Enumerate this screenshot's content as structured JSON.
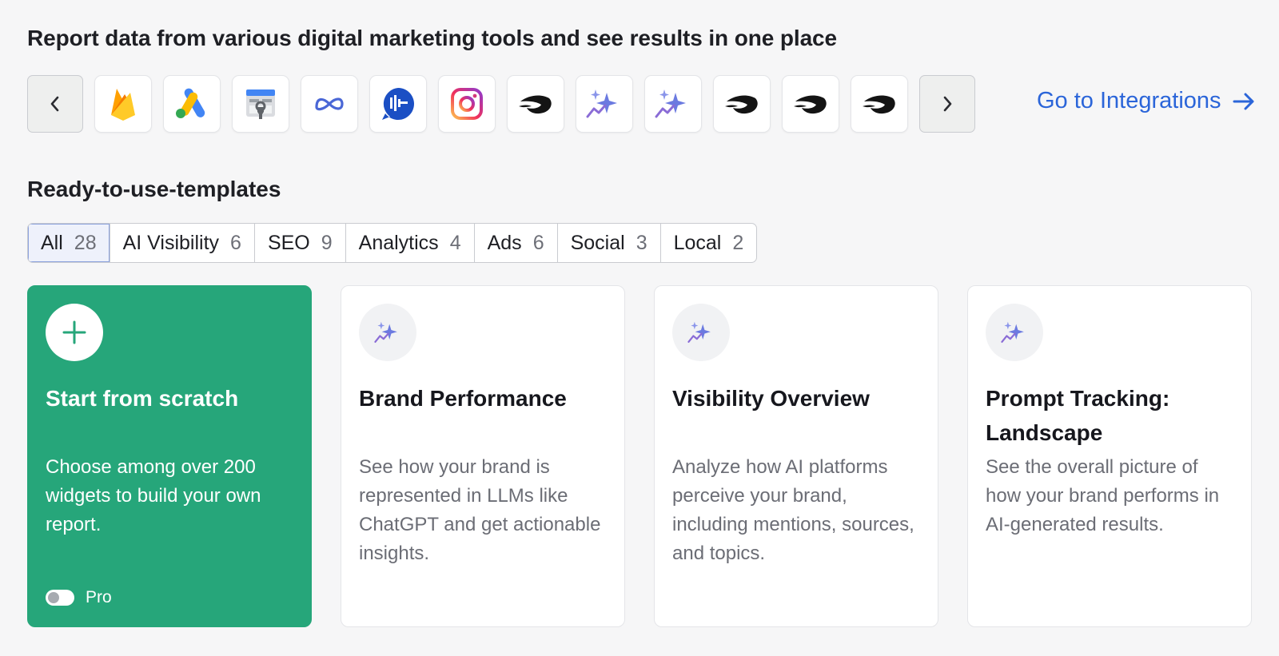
{
  "heading": "Report data from various digital marketing tools and see results in one place",
  "integrations": {
    "prev_label": "previous",
    "next_label": "next",
    "tools": [
      "firebase-icon",
      "google-ads-icon",
      "google-search-console-icon",
      "meta-icon",
      "dialpad-icon",
      "instagram-icon",
      "semrush-icon",
      "ai-sparkle-icon",
      "ai-sparkle-icon",
      "semrush-icon",
      "semrush-icon",
      "semrush-icon"
    ],
    "link_label": "Go to Integrations",
    "link_color": "#2b65d9"
  },
  "templates_heading": "Ready-to-use-templates",
  "tabs": [
    {
      "label": "All",
      "count": "28",
      "active": true
    },
    {
      "label": "AI Visibility",
      "count": "6"
    },
    {
      "label": "SEO",
      "count": "9"
    },
    {
      "label": "Analytics",
      "count": "4"
    },
    {
      "label": "Ads",
      "count": "6"
    },
    {
      "label": "Social",
      "count": "3"
    },
    {
      "label": "Local",
      "count": "2"
    }
  ],
  "cards": [
    {
      "title": "Start from scratch",
      "desc": "Choose among over 200 widgets to build your own report.",
      "icon": "plus-icon",
      "toggle_label": "Pro",
      "color": "#26a67a"
    },
    {
      "title": "Brand Performance",
      "desc": "See how your brand is represented in LLMs like ChatGPT and get actionable insights.",
      "icon": "ai-sparkle-icon"
    },
    {
      "title": "Visibility Overview",
      "desc": "Analyze how AI platforms perceive your brand, including mentions, sources, and topics.",
      "icon": "ai-sparkle-icon"
    },
    {
      "title": "Prompt Tracking: Landscape",
      "desc": "See the overall picture of how your brand performs in AI-generated results.",
      "icon": "ai-sparkle-icon"
    }
  ]
}
